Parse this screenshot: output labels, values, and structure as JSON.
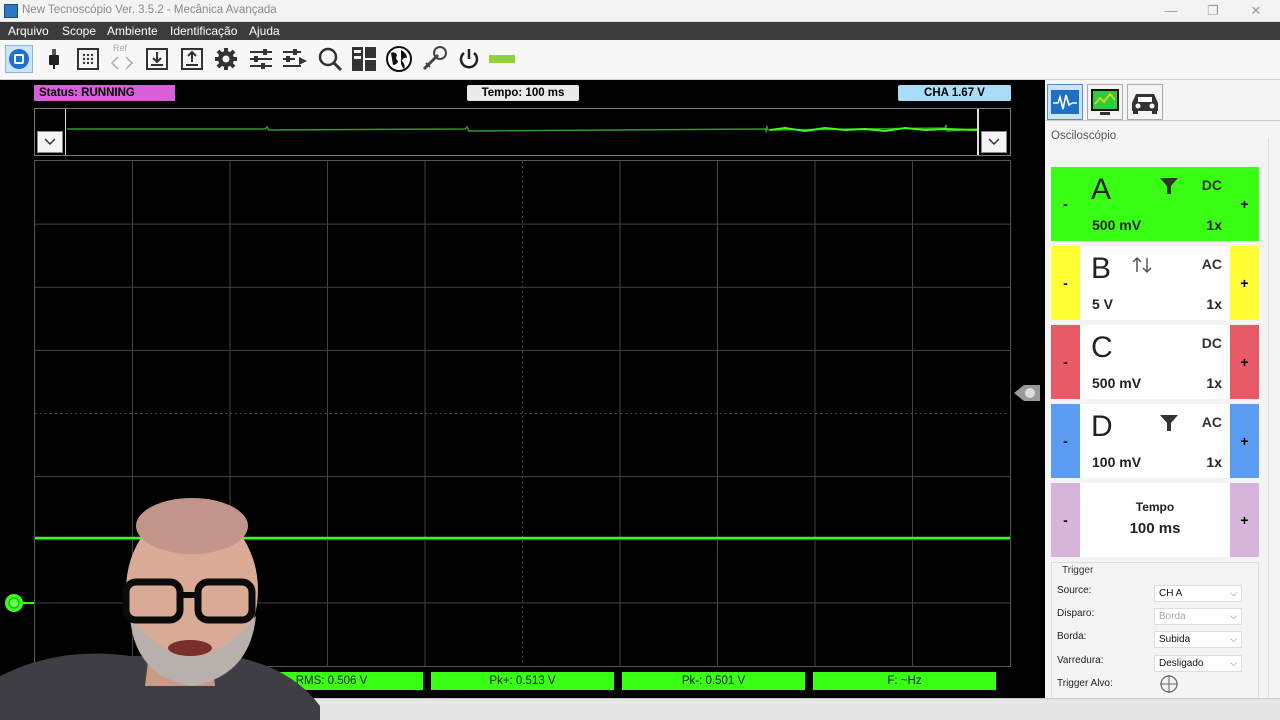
{
  "window": {
    "title": "New Tecnoscópio Ver. 3.5.2  - Mecânica Avançada",
    "min": "—",
    "max": "❐",
    "close": "✕"
  },
  "menu": [
    "Arquivo",
    "Scope",
    "Ambiente",
    "Identificação",
    "Ajuda"
  ],
  "toolbar": {
    "ref_label": "Ref",
    "icons": [
      "run-stop-icon",
      "probe-icon",
      "grid-icon",
      "ref-arrows-icon",
      "save-icon",
      "load-icon",
      "gear-icon",
      "sliders-icon",
      "sliders-arrow-icon",
      "zoom-icon",
      "layout-icon",
      "globe-icon",
      "tool-icon",
      "power-icon",
      "battery-icon"
    ]
  },
  "scope": {
    "status": "Status: RUNNING",
    "tempo": "Tempo: 100 ms",
    "cha": "CHA 1.67 V",
    "trace_color": "#39ff14",
    "grid_divisions": {
      "x": 10,
      "y": 8
    }
  },
  "measurements": [
    {
      "label": "RMS: 0.506 V"
    },
    {
      "label": "Pk+: 0.513 V"
    },
    {
      "label": "Pk-: 0.501 V"
    },
    {
      "label": "F: ~Hz"
    }
  ],
  "right_panel": {
    "title": "Osciloscópio",
    "tabs": [
      "scope-tab-icon",
      "monitor-tab-icon",
      "car-tab-icon"
    ],
    "channels": [
      {
        "name": "A",
        "volts": "500 mV",
        "coupling": "DC",
        "probe": "1x",
        "color": "#39ff14",
        "filter": true,
        "selected": true
      },
      {
        "name": "B",
        "volts": "5 V",
        "coupling": "AC",
        "probe": "1x",
        "color": "#ffff33",
        "arrows": true
      },
      {
        "name": "C",
        "volts": "500 mV",
        "coupling": "DC",
        "probe": "1x",
        "color": "#e85a66"
      },
      {
        "name": "D",
        "volts": "100 mV",
        "coupling": "AC",
        "probe": "1x",
        "color": "#5a9cf0",
        "filter": true
      }
    ],
    "tempo": {
      "label": "Tempo",
      "value": "100 ms",
      "color": "#d8b6dc"
    },
    "minus": "-",
    "plus": "+",
    "trigger": {
      "title": "Trigger",
      "source_label": "Source:",
      "source_value": "CH A",
      "disparo_label": "Disparo:",
      "disparo_value": "Borda",
      "borda_label": "Borda:",
      "borda_value": "Subida",
      "varredura_label": "Varredura:",
      "varredura_value": "Desligado",
      "alvo_label": "Trigger Alvo:"
    }
  }
}
